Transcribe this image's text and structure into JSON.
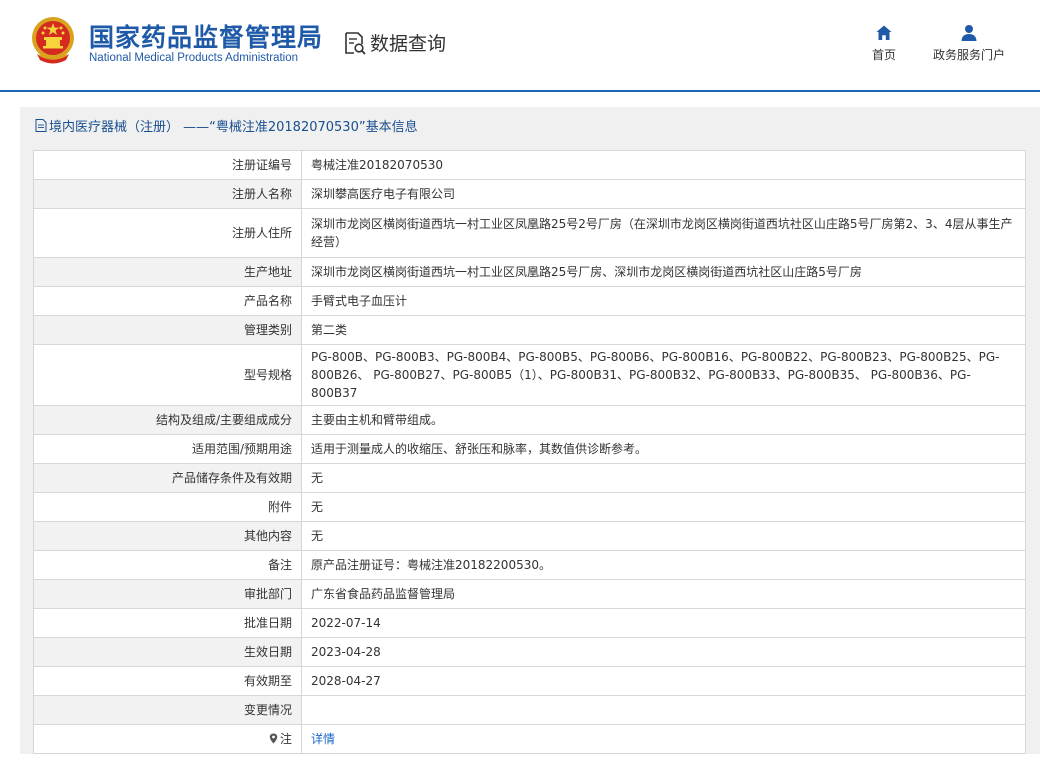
{
  "header": {
    "brand_cn": "国家药品监督管理局",
    "brand_en": "National Medical Products Administration",
    "query_title": "数据查询",
    "nav_home": "首页",
    "nav_portal": "政务服务门户"
  },
  "panel": {
    "title": "境内医疗器械（注册） ——“粤械注准20182070530”基本信息"
  },
  "rows": [
    {
      "label": "注册证编号",
      "value": "粤械注准20182070530"
    },
    {
      "label": "注册人名称",
      "value": "深圳攀高医疗电子有限公司"
    },
    {
      "label": "注册人住所",
      "value": "深圳市龙岗区横岗街道西坑一村工业区凤凰路25号2号厂房（在深圳市龙岗区横岗街道西坑社区山庄路5号厂房第2、3、4层从事生产经营）"
    },
    {
      "label": "生产地址",
      "value": "深圳市龙岗区横岗街道西坑一村工业区凤凰路25号厂房、深圳市龙岗区横岗街道西坑社区山庄路5号厂房"
    },
    {
      "label": "产品名称",
      "value": "手臂式电子血压计"
    },
    {
      "label": "管理类别",
      "value": "第二类"
    },
    {
      "label": "型号规格",
      "value": "PG-800B、PG-800B3、PG-800B4、PG-800B5、PG-800B6、PG-800B16、PG-800B22、PG-800B23、PG-800B25、PG-800B26、 PG-800B27、PG-800B5（1）、PG-800B31、PG-800B32、PG-800B33、PG-800B35、 PG-800B36、PG-800B37"
    },
    {
      "label": "结构及组成/主要组成成分",
      "value": "主要由主机和臂带组成。"
    },
    {
      "label": "适用范围/预期用途",
      "value": "适用于测量成人的收缩压、舒张压和脉率，其数值供诊断参考。"
    },
    {
      "label": "产品储存条件及有效期",
      "value": "无"
    },
    {
      "label": "附件",
      "value": "无"
    },
    {
      "label": "其他内容",
      "value": "无"
    },
    {
      "label": "备注",
      "value": "原产品注册证号：粤械注准20182200530。"
    },
    {
      "label": "审批部门",
      "value": "广东省食品药品监督管理局"
    },
    {
      "label": "批准日期",
      "value": "2022-07-14"
    },
    {
      "label": "生效日期",
      "value": "2023-04-28"
    },
    {
      "label": "有效期至",
      "value": "2028-04-27"
    },
    {
      "label": "变更情况",
      "value": ""
    },
    {
      "label": "注",
      "value": "详情"
    }
  ]
}
